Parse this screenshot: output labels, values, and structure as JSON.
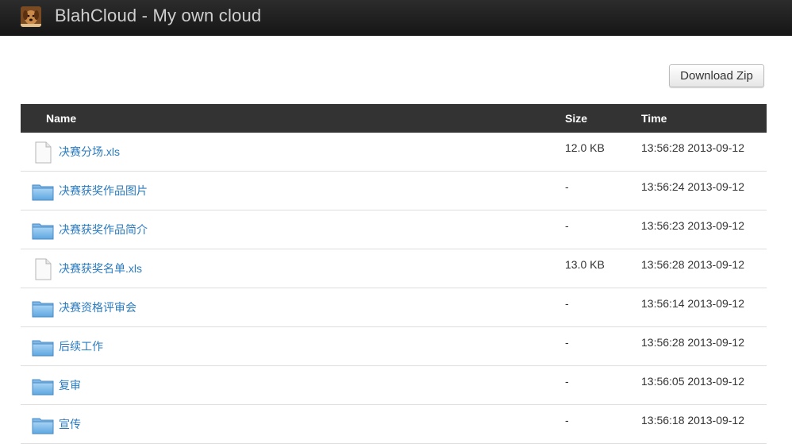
{
  "header": {
    "title": "BlahCloud - My own cloud",
    "logo_icon": "dog-avatar-icon"
  },
  "toolbar": {
    "download_label": "Download Zip"
  },
  "table": {
    "columns": {
      "name": "Name",
      "size": "Size",
      "time": "Time"
    },
    "rows": [
      {
        "type": "file",
        "name": "决赛分场.xls",
        "size": "12.0 KB",
        "time": "13:56:28 2013-09-12"
      },
      {
        "type": "folder",
        "name": "决赛获奖作品图片",
        "size": "-",
        "time": "13:56:24 2013-09-12"
      },
      {
        "type": "folder",
        "name": "决赛获奖作品简介",
        "size": "-",
        "time": "13:56:23 2013-09-12"
      },
      {
        "type": "file",
        "name": "决赛获奖名单.xls",
        "size": "13.0 KB",
        "time": "13:56:28 2013-09-12"
      },
      {
        "type": "folder",
        "name": "决赛资格评审会",
        "size": "-",
        "time": "13:56:14 2013-09-12"
      },
      {
        "type": "folder",
        "name": "后续工作",
        "size": "-",
        "time": "13:56:28 2013-09-12"
      },
      {
        "type": "folder",
        "name": "复审",
        "size": "-",
        "time": "13:56:05 2013-09-12"
      },
      {
        "type": "folder",
        "name": "宣传",
        "size": "-",
        "time": "13:56:18 2013-09-12"
      }
    ]
  },
  "colors": {
    "header_bg": "#1e1e1e",
    "table_header_bg": "#333333",
    "link": "#2a7bbf"
  }
}
